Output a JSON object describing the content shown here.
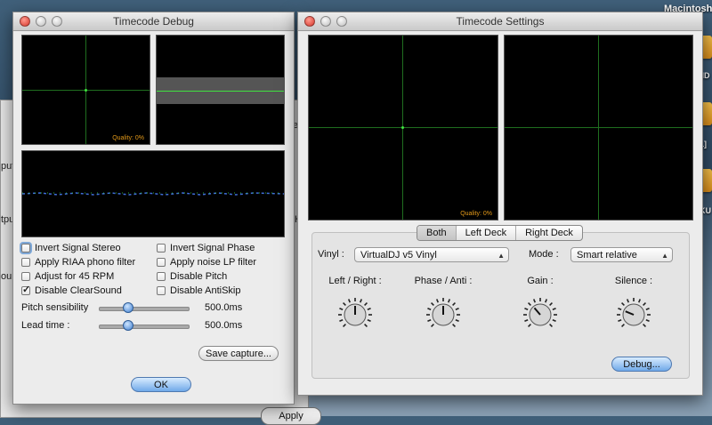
{
  "desktop": {
    "volume_label": "Macintosh",
    "files": [
      {
        "label": "UND"
      },
      {
        "label": "LL]"
      },
      {
        "label": "EKU"
      }
    ]
  },
  "background_window": {
    "fragments": [
      "e",
      "put",
      "tput",
      "ou",
      "H",
      "Apply"
    ]
  },
  "debug_window": {
    "title": "Timecode Debug",
    "quality_label": "Quality: 0%",
    "checkboxes": [
      {
        "label": "Invert Signal Stereo",
        "checked": false
      },
      {
        "label": "Invert Signal Phase",
        "checked": false
      },
      {
        "label": "Apply RIAA phono filter",
        "checked": false
      },
      {
        "label": "Apply noise LP filter",
        "checked": false
      },
      {
        "label": "Adjust for 45 RPM",
        "checked": false
      },
      {
        "label": "Disable Pitch",
        "checked": false
      },
      {
        "label": "Disable ClearSound",
        "checked": true
      },
      {
        "label": "Disable AntiSkip",
        "checked": false
      }
    ],
    "sliders": [
      {
        "label": "Pitch sensibility",
        "value_text": "500.0ms",
        "position": 0.33
      },
      {
        "label": "Lead time :",
        "value_text": "500.0ms",
        "position": 0.33
      }
    ],
    "save_capture_label": "Save capture...",
    "ok_label": "OK"
  },
  "settings_window": {
    "title": "Timecode Settings",
    "quality_label": "Quality: 0%",
    "tabs": [
      {
        "label": "Both",
        "selected": true
      },
      {
        "label": "Left Deck",
        "selected": false
      },
      {
        "label": "Right Deck",
        "selected": false
      }
    ],
    "vinyl_label": "Vinyl :",
    "vinyl_value": "VirtualDJ v5 Vinyl",
    "mode_label": "Mode :",
    "mode_value": "Smart relative",
    "knobs": [
      {
        "label": "Left / Right :",
        "value": 0.5
      },
      {
        "label": "Phase / Anti :",
        "value": 0.5
      },
      {
        "label": "Gain :",
        "value": 0.35
      },
      {
        "label": "Silence :",
        "value": 0.25
      }
    ],
    "debug_label": "Debug..."
  },
  "colors": {
    "scope_bg": "#000000",
    "grid_green": "#1f6e1f",
    "trace_green": "#3fe33f",
    "quality_orange": "#e49a1a",
    "accent_blue": "#3f7fd0"
  }
}
